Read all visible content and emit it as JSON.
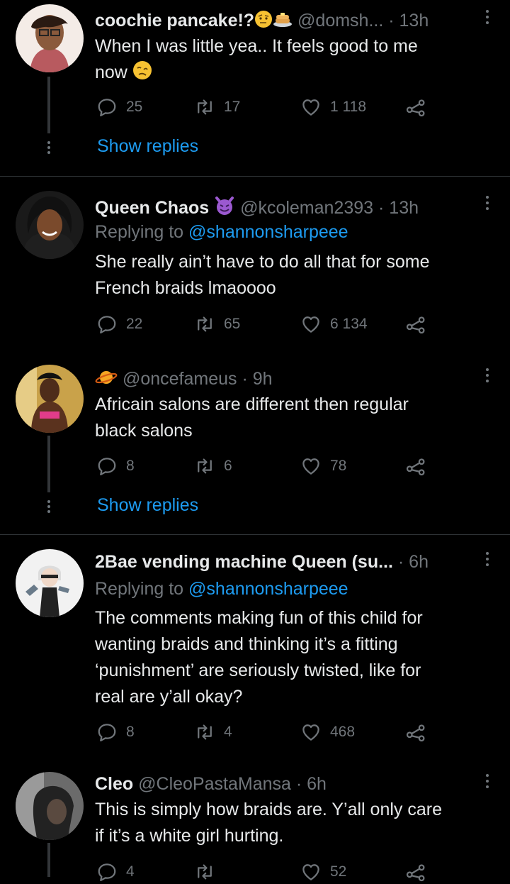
{
  "tweets": [
    {
      "name": "coochie pancake!?",
      "handle": "@domsh...",
      "time": "· 13h",
      "text_lines": [
        "When I was little yea..  It feels good to me",
        "now"
      ],
      "replies": "25",
      "retweets": "17",
      "likes": "1 118",
      "show_replies": "Show replies"
    },
    {
      "name": "Queen Chaos",
      "handle": "@kcoleman2393",
      "time": "· 13h",
      "replying_prefix": "Replying to",
      "replying_handle": "@shannonsharpeee",
      "text_lines": [
        "She really ain’t have to do all that for some",
        "French braids lmaoooo"
      ],
      "replies": "22",
      "retweets": "65",
      "likes": "6 134"
    },
    {
      "handle": "@oncefameus",
      "time": "· 9h",
      "text_lines": [
        "Africain salons are different then regular",
        "black salons"
      ],
      "replies": "8",
      "retweets": "6",
      "likes": "78",
      "show_replies": "Show replies"
    },
    {
      "name": "2Bae vending machine Queen (su...",
      "time": "· 6h",
      "replying_prefix": "Replying to",
      "replying_handle": "@shannonsharpeee",
      "text_lines": [
        "The comments making fun of this child for",
        "wanting braids and thinking it’s a fitting",
        "‘punishment’ are seriously twisted, like for",
        "real are y’all okay?"
      ],
      "replies": "8",
      "retweets": "4",
      "likes": "468"
    },
    {
      "name": "Cleo",
      "handle": "@CleoPastaMansa",
      "time": "· 6h",
      "text_lines": [
        "This is simply how braids are. Y’all only care",
        "if it’s a white girl hurting."
      ],
      "replies": "4",
      "retweets": "",
      "likes": "52"
    }
  ],
  "colors": {
    "background": "#000000",
    "text": "#e7e9ea",
    "muted": "#71767b",
    "link": "#1d9bf0",
    "divider": "#2f3336"
  },
  "icons": [
    "reply-icon",
    "retweet-icon",
    "like-icon",
    "share-icon",
    "more-icon"
  ]
}
